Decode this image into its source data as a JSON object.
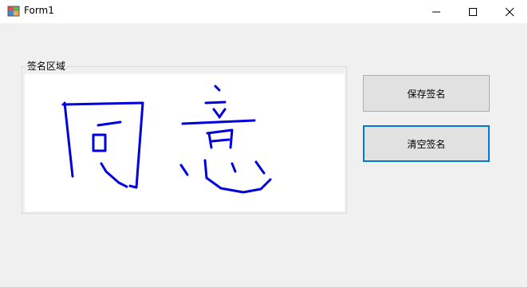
{
  "window": {
    "title": "Form1"
  },
  "titlebar_buttons": {
    "minimize": "minimize-icon",
    "maximize": "maximize-icon",
    "close": "close-icon"
  },
  "signature_group": {
    "label": "签名区域"
  },
  "buttons": {
    "save_label": "保存签名",
    "clear_label": "清空签名"
  },
  "colors": {
    "ink": "#0000dd",
    "focus_border": "#0078d7",
    "button_bg": "#e1e1e1"
  }
}
